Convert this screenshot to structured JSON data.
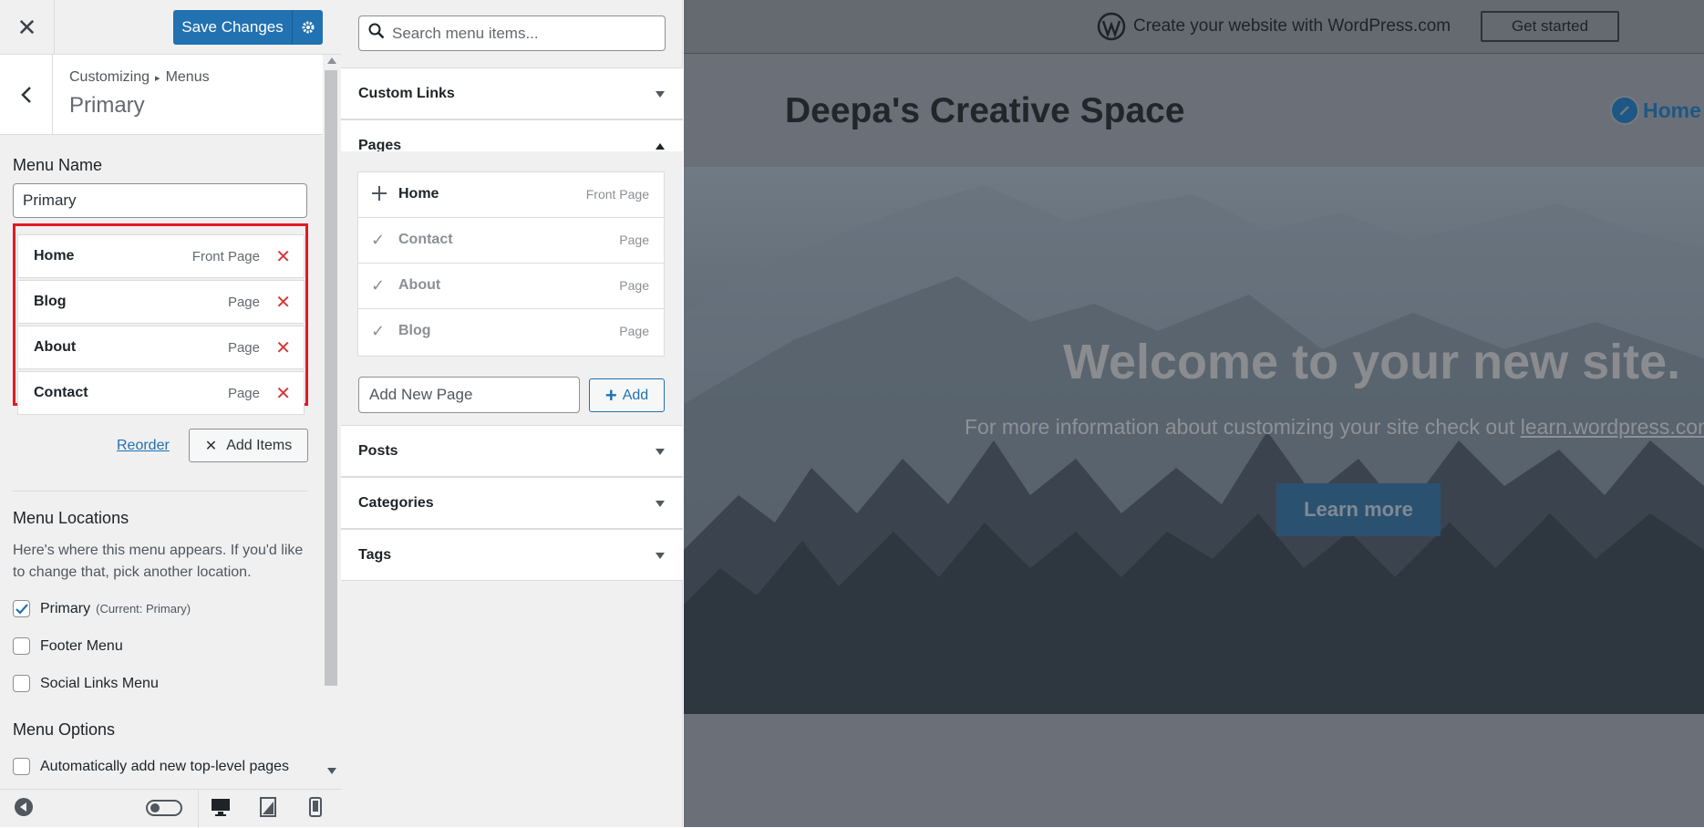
{
  "topbar": {
    "close_icon": "close-icon",
    "save_label": "Save Changes",
    "settings_icon": "gear-icon"
  },
  "panel": {
    "breadcrumb_root": "Customizing",
    "breadcrumb_sep": "▸",
    "breadcrumb_section": "Menus",
    "title": "Primary"
  },
  "menu_name": {
    "label": "Menu Name",
    "value": "Primary"
  },
  "menu_items": [
    {
      "title": "Home",
      "type": "Front Page"
    },
    {
      "title": "Blog",
      "type": "Page"
    },
    {
      "title": "About",
      "type": "Page"
    },
    {
      "title": "Contact",
      "type": "Page"
    }
  ],
  "actions": {
    "reorder": "Reorder",
    "add_items": "Add Items"
  },
  "locations": {
    "heading": "Menu Locations",
    "description": "Here's where this menu appears. If you'd like to change that, pick another location.",
    "items": [
      {
        "label": "Primary",
        "sub": "(Current: Primary)",
        "checked": true
      },
      {
        "label": "Footer Menu",
        "sub": "",
        "checked": false
      },
      {
        "label": "Social Links Menu",
        "sub": "",
        "checked": false
      }
    ]
  },
  "options": {
    "heading": "Menu Options",
    "auto_add": "Automatically add new top-level pages",
    "auto_add_checked": false
  },
  "available": {
    "search_placeholder": "Search menu items...",
    "sections": [
      "Custom Links",
      "Pages",
      "Posts",
      "Categories",
      "Tags"
    ],
    "pages": [
      {
        "title": "Home",
        "type": "Front Page",
        "added": false
      },
      {
        "title": "Contact",
        "type": "Page",
        "added": true
      },
      {
        "title": "About",
        "type": "Page",
        "added": true
      },
      {
        "title": "Blog",
        "type": "Page",
        "added": true
      }
    ],
    "new_page_placeholder": "Add New Page",
    "add_label": "Add"
  },
  "preview": {
    "wpcom_message": "Create your website with WordPress.com",
    "get_started": "Get started",
    "site_title": "Deepa's Creative Space",
    "nav_home": "Home",
    "hero_heading": "Welcome to your new site.",
    "hero_text": "For more information about customizing your site check out ",
    "hero_link": "learn.wordpress.com",
    "learn_more": "Learn more"
  },
  "colors": {
    "accent": "#2271b1",
    "highlight_border": "#e01b22",
    "remove": "#d63638"
  }
}
